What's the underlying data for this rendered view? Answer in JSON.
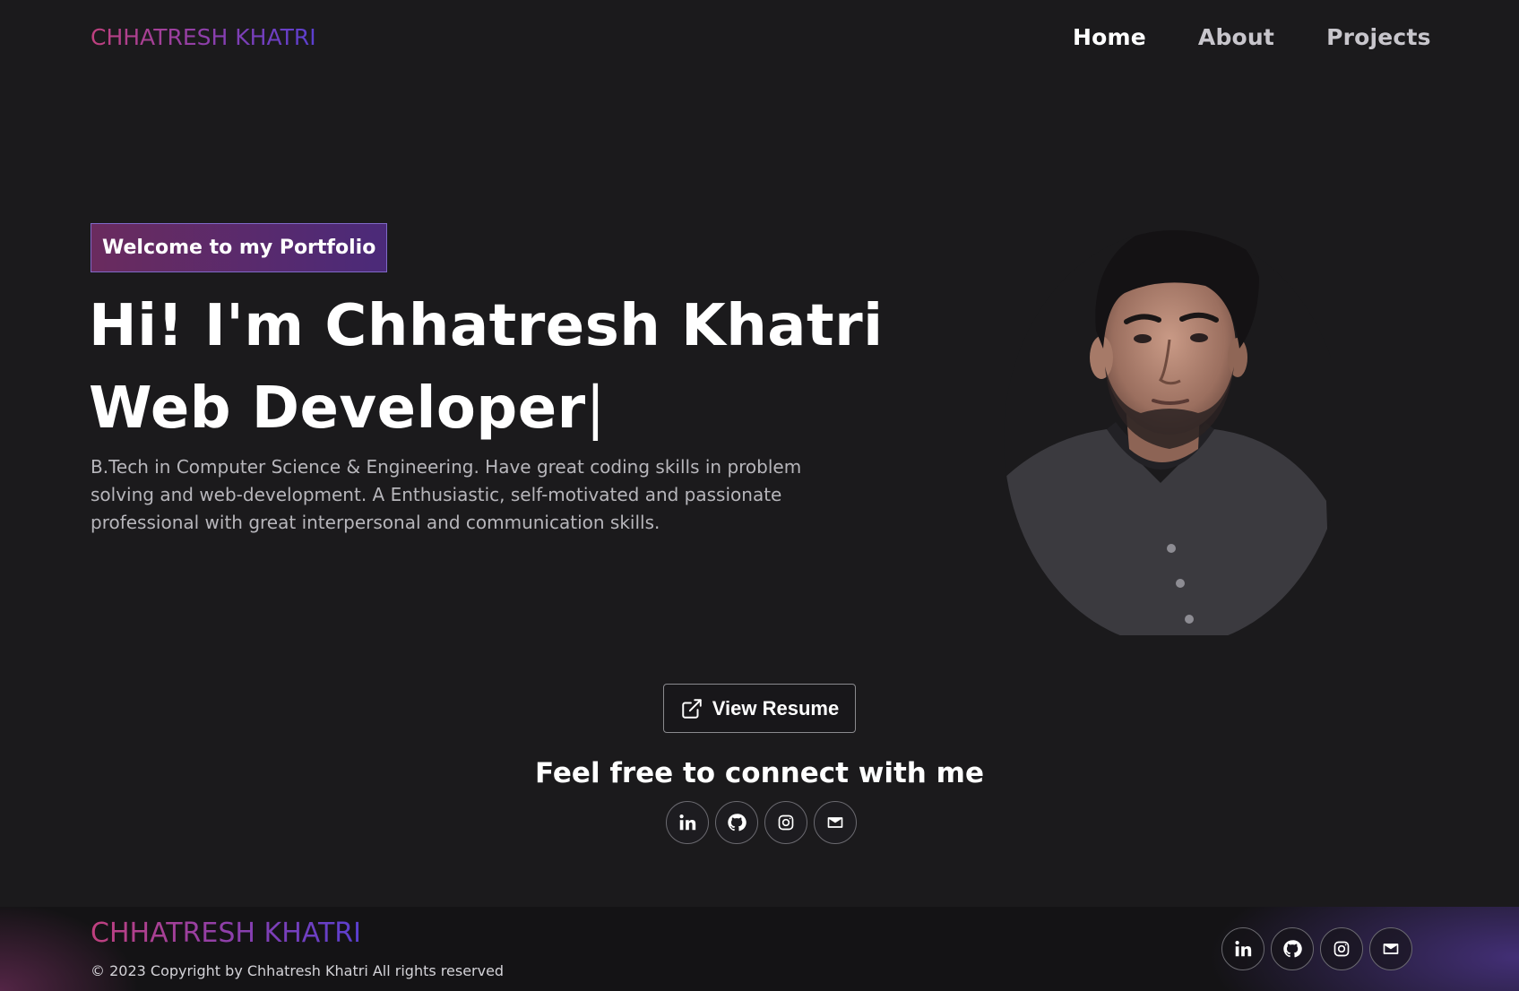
{
  "nav": {
    "logo": "CHHATRESH KHATRI",
    "links": [
      {
        "label": "Home",
        "active": true
      },
      {
        "label": "About",
        "active": false
      },
      {
        "label": "Projects",
        "active": false
      }
    ]
  },
  "hero": {
    "tag": "Welcome to my Portfolio",
    "title_line1": "Hi! I'm Chhatresh Khatri",
    "title_line2": "Web Developer",
    "cursor": "|",
    "description": "B.Tech in Computer Science & Engineering. Have great coding skills in problem solving and web-development. A Enthusiastic, self-motivated and passionate professional with great interpersonal and communication skills."
  },
  "cta": {
    "resume_label": "View Resume",
    "resume_icon": "external-link-icon",
    "connect_title": "Feel free to connect with me"
  },
  "social": [
    {
      "name": "linkedin",
      "icon": "linkedin-icon"
    },
    {
      "name": "github",
      "icon": "github-icon"
    },
    {
      "name": "instagram",
      "icon": "instagram-icon"
    },
    {
      "name": "email",
      "icon": "mail-icon"
    }
  ],
  "footer": {
    "logo": "CHHATRESH KHATRI",
    "copyright": "© 2023 Copyright by Chhatresh Khatri All rights reserved"
  },
  "colors": {
    "background": "#1b1a1c",
    "gradient_start": "#c0407e",
    "gradient_end": "#5a3fd0"
  }
}
